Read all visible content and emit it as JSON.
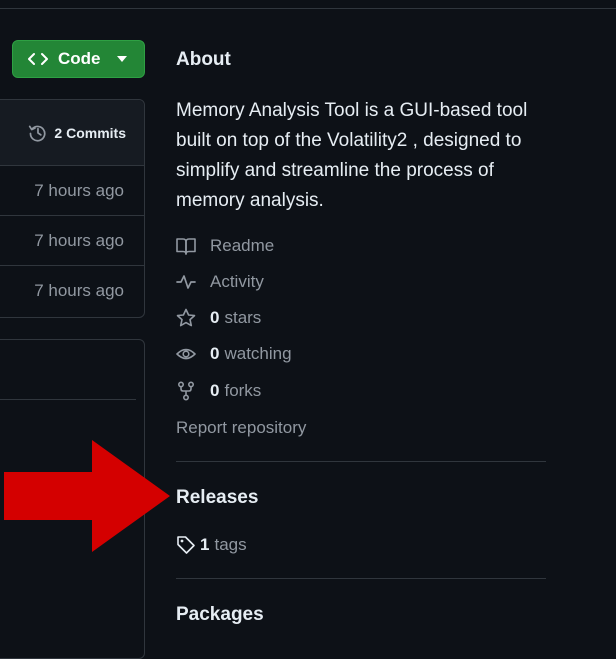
{
  "code_button": {
    "label": "Code"
  },
  "commits": {
    "label": "2 Commits",
    "rows": [
      {
        "time": "7 hours ago"
      },
      {
        "time": "7 hours ago"
      },
      {
        "time": "7 hours ago"
      }
    ]
  },
  "about": {
    "title": "About",
    "description": "Memory Analysis Tool is a GUI-based tool built on top of the Volatility2 , designed to simplify and streamline the process of memory analysis.",
    "readme": "Readme",
    "activity": "Activity",
    "stars_count": "0",
    "stars_label": "stars",
    "watching_count": "0",
    "watching_label": "watching",
    "forks_count": "0",
    "forks_label": "forks",
    "report": "Report repository"
  },
  "releases": {
    "title": "Releases",
    "tags_count": "1",
    "tags_label": "tags"
  },
  "packages": {
    "title": "Packages"
  },
  "colors": {
    "accent_green": "#238636",
    "annotation_arrow": "#d40000",
    "background": "#0d1117"
  }
}
